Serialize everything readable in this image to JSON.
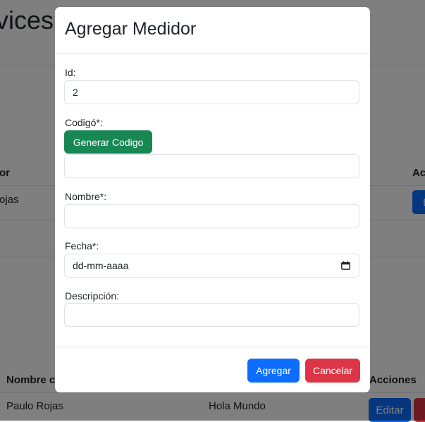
{
  "background": {
    "page_title": "vices",
    "table1": {
      "header_col1": "or",
      "header_actions": "Ac",
      "row_name": "ojas",
      "row_button": "E"
    },
    "table2": {
      "header_name": "Nombre cl",
      "header_actions": "Acciones",
      "row_name": "Paulo Rojas",
      "row_description": "Hola Mundo",
      "edit_label": "Editar",
      "delete_label": "E"
    }
  },
  "modal": {
    "title": "Agregar Medidor",
    "fields": {
      "id": {
        "label": "Id:",
        "value": "2"
      },
      "codigo": {
        "label": "Codigó*:",
        "generate_label": "Generar Codigo",
        "value": ""
      },
      "nombre": {
        "label": "Nombre*:",
        "value": ""
      },
      "fecha": {
        "label": "Fecha*:",
        "placeholder": "dd-mm-aaaa",
        "icon": "calendar-icon"
      },
      "descripcion": {
        "label": "Descripción:",
        "value": ""
      }
    },
    "footer": {
      "add_label": "Agregar",
      "cancel_label": "Cancelar"
    }
  },
  "colors": {
    "primary": "#0d6efd",
    "success": "#198754",
    "danger": "#dc3545",
    "backdrop": "rgba(0,0,0,0.5)"
  }
}
